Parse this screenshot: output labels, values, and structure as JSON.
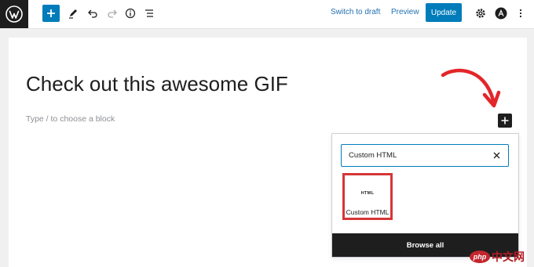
{
  "toolbar": {
    "switch_to_draft": "Switch to draft",
    "preview": "Preview",
    "update": "Update"
  },
  "editor": {
    "title": "Check out this awesome GIF",
    "placeholder": "Type / to choose a block"
  },
  "inserter": {
    "search_value": "Custom HTML",
    "block_icon_text": "HTML",
    "block_label": "Custom HTML",
    "browse_all": "Browse all"
  },
  "watermark": {
    "logo": "php",
    "text": "中文网"
  },
  "colors": {
    "accent": "#007cba",
    "highlight": "#d63638",
    "arrow": "#e3262a",
    "dark": "#1e1e1e"
  },
  "icons": [
    "wordpress-logo",
    "plus-icon",
    "pencil-icon",
    "undo-icon",
    "redo-icon",
    "info-icon",
    "list-view-icon",
    "gear-icon",
    "plugin-avatar-icon",
    "more-vertical-icon",
    "close-icon",
    "curved-arrow"
  ]
}
